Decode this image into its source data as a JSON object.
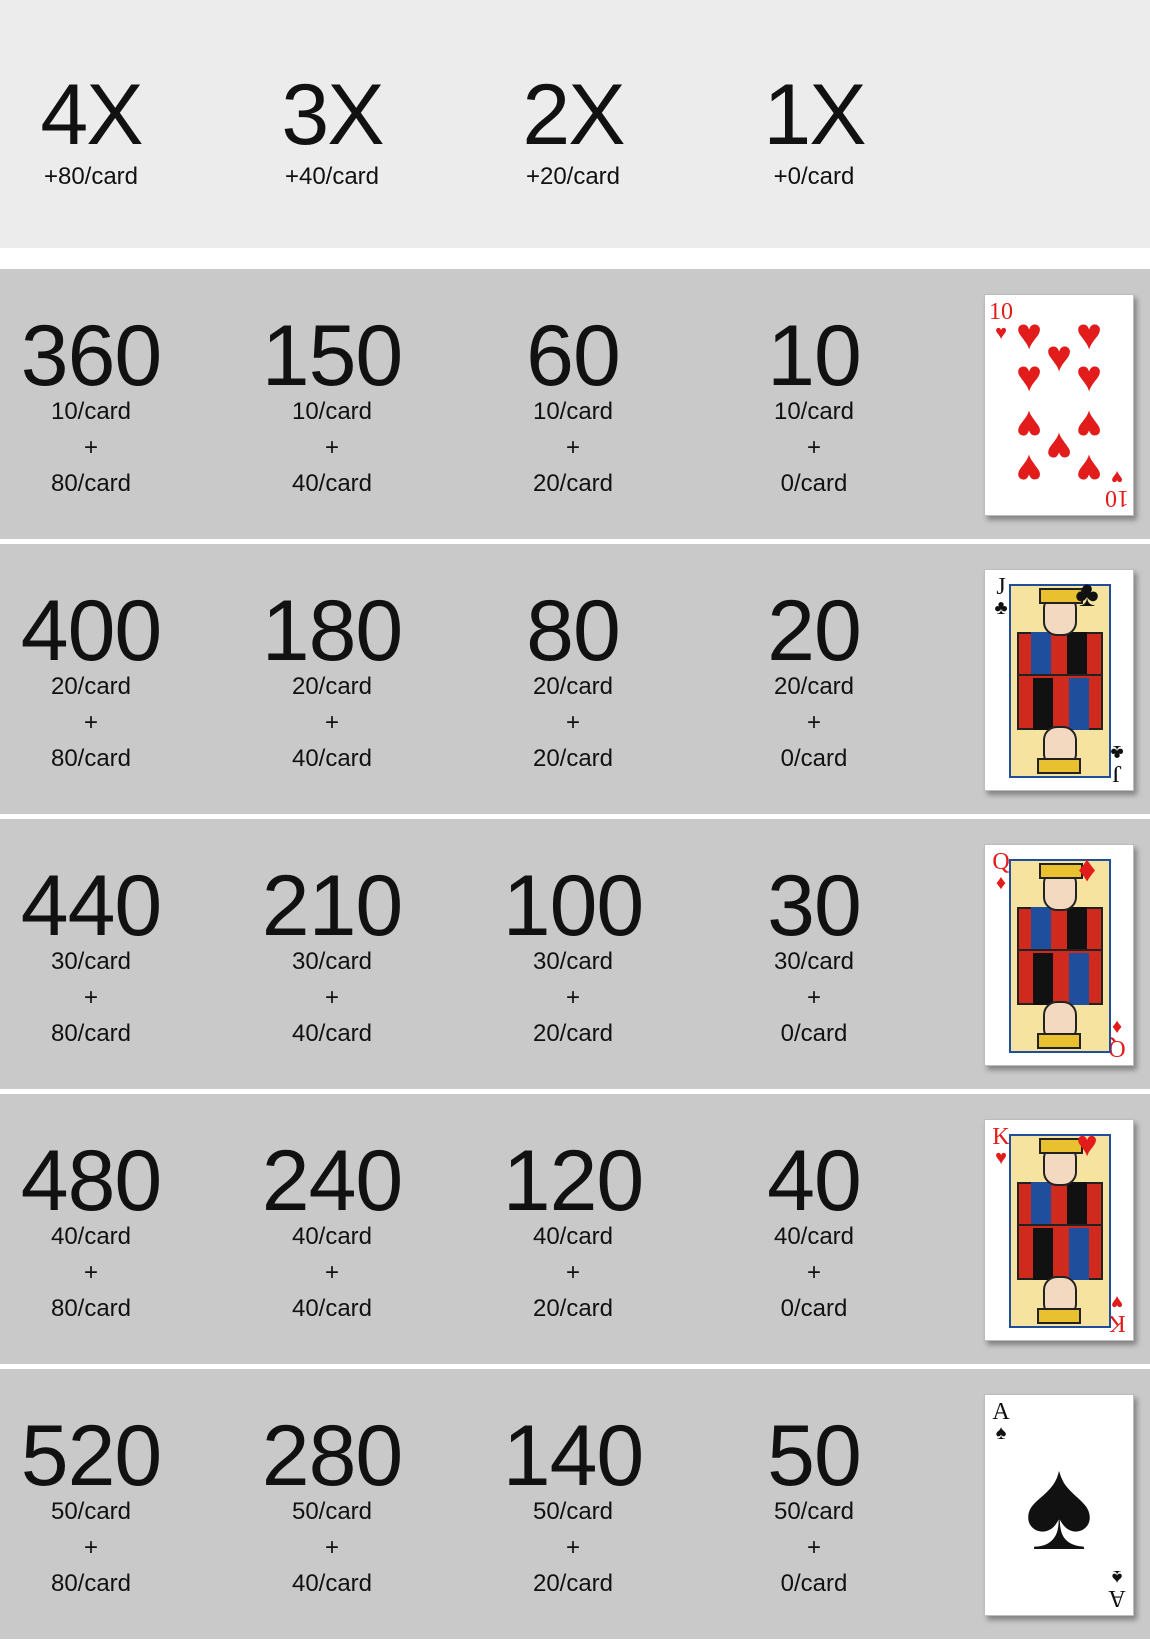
{
  "multipliers": [
    {
      "label": "4X",
      "bonus": "+80/card"
    },
    {
      "label": "3X",
      "bonus": "+40/card"
    },
    {
      "label": "2X",
      "bonus": "+20/card"
    },
    {
      "label": "1X",
      "bonus": "+0/card"
    }
  ],
  "plus_sign": "+",
  "rows": [
    {
      "card": {
        "rank": "10",
        "suit": "♥",
        "suit_name": "hearts",
        "icon": "ten-of-hearts-card-icon"
      },
      "cells": [
        {
          "total": "360",
          "base": "10/card",
          "bonus": "80/card"
        },
        {
          "total": "150",
          "base": "10/card",
          "bonus": "40/card"
        },
        {
          "total": "60",
          "base": "10/card",
          "bonus": "20/card"
        },
        {
          "total": "10",
          "base": "10/card",
          "bonus": "0/card"
        }
      ]
    },
    {
      "card": {
        "rank": "J",
        "suit": "♣",
        "suit_name": "clubs",
        "icon": "jack-of-clubs-card-icon"
      },
      "cells": [
        {
          "total": "400",
          "base": "20/card",
          "bonus": "80/card"
        },
        {
          "total": "180",
          "base": "20/card",
          "bonus": "40/card"
        },
        {
          "total": "80",
          "base": "20/card",
          "bonus": "20/card"
        },
        {
          "total": "20",
          "base": "20/card",
          "bonus": "0/card"
        }
      ]
    },
    {
      "card": {
        "rank": "Q",
        "suit": "♦",
        "suit_name": "diamonds",
        "icon": "queen-of-diamonds-card-icon"
      },
      "cells": [
        {
          "total": "440",
          "base": "30/card",
          "bonus": "80/card"
        },
        {
          "total": "210",
          "base": "30/card",
          "bonus": "40/card"
        },
        {
          "total": "100",
          "base": "30/card",
          "bonus": "20/card"
        },
        {
          "total": "30",
          "base": "30/card",
          "bonus": "0/card"
        }
      ]
    },
    {
      "card": {
        "rank": "K",
        "suit": "♥",
        "suit_name": "hearts",
        "icon": "king-of-hearts-card-icon"
      },
      "cells": [
        {
          "total": "480",
          "base": "40/card",
          "bonus": "80/card"
        },
        {
          "total": "240",
          "base": "40/card",
          "bonus": "40/card"
        },
        {
          "total": "120",
          "base": "40/card",
          "bonus": "20/card"
        },
        {
          "total": "40",
          "base": "40/card",
          "bonus": "0/card"
        }
      ]
    },
    {
      "card": {
        "rank": "A",
        "suit": "♠",
        "suit_name": "spades",
        "icon": "ace-of-spades-card-icon"
      },
      "cells": [
        {
          "total": "520",
          "base": "50/card",
          "bonus": "80/card"
        },
        {
          "total": "280",
          "base": "50/card",
          "bonus": "40/card"
        },
        {
          "total": "140",
          "base": "50/card",
          "bonus": "20/card"
        },
        {
          "total": "50",
          "base": "50/card",
          "bonus": "0/card"
        }
      ]
    }
  ],
  "colors": {
    "header_bg": "#ececec",
    "row_bg": "#c9c9c9",
    "text": "#111111",
    "red_suit": "#e21b1b",
    "black_suit": "#111111"
  }
}
